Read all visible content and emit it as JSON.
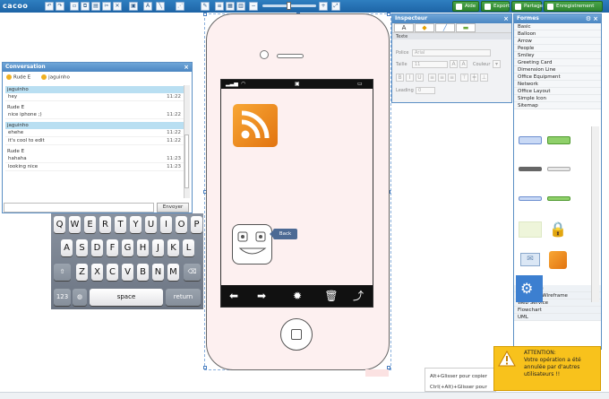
{
  "toolbar": {
    "logo": "cacoo",
    "help_label": "Aide",
    "export_label": "Export",
    "share_label": "Partage",
    "save_label": "Enregistrement"
  },
  "conversation": {
    "title": "Conversation",
    "users": [
      "Rude E",
      "jaguinho"
    ],
    "messages": [
      {
        "author": "jaguinho",
        "highlight": true,
        "lines": [
          {
            "text": "hey",
            "time": "11:22"
          }
        ]
      },
      {
        "author": "Rude E",
        "highlight": false,
        "lines": [
          {
            "text": "nice iphone ;)",
            "time": "11:22"
          }
        ]
      },
      {
        "author": "jaguinho",
        "highlight": true,
        "lines": [
          {
            "text": "ehehe",
            "time": "11:22"
          },
          {
            "text": "it's cool to edit",
            "time": "11:22"
          }
        ]
      },
      {
        "author": "Rude E",
        "highlight": false,
        "lines": [
          {
            "text": "hahaha",
            "time": "11:23"
          },
          {
            "text": "looking nice",
            "time": "11:23"
          }
        ]
      }
    ],
    "send_label": "Envoyer"
  },
  "keyboard": {
    "row1": [
      "Q",
      "W",
      "E",
      "R",
      "T",
      "Y",
      "U",
      "I",
      "O",
      "P"
    ],
    "row2": [
      "A",
      "S",
      "D",
      "F",
      "G",
      "H",
      "J",
      "K",
      "L"
    ],
    "row3": [
      "Z",
      "X",
      "C",
      "V",
      "B",
      "N",
      "M"
    ],
    "numbers_label": "123",
    "space_label": "space",
    "return_label": "return"
  },
  "phone": {
    "back_label": "Back"
  },
  "inspector": {
    "title": "Inspecteur",
    "section": "Texte",
    "police_label": "Police",
    "police_value": "Arial",
    "taille_label": "Taille",
    "taille_value": "11",
    "couleur_label": "Couleur",
    "leading_label": "Leading",
    "leading_value": "0"
  },
  "shapes": {
    "title": "Formes",
    "categories_top": [
      "Basic",
      "Balloon",
      "Arrow",
      "People",
      "Smiley",
      "Greeting Card",
      "Dimension Line",
      "Office Equipment",
      "Network",
      "Office Layout",
      "Simple Icon",
      "Sitemap"
    ],
    "categories_bottom": [
      "Wireframe",
      "Freehand Wireframe",
      "Web Service",
      "Flowchart",
      "UML"
    ]
  },
  "tooltip": {
    "line1": "Alt+Glisser pour copier",
    "line2": "Ctrl(+Alt)+Glisser pour"
  },
  "warning": {
    "heading": "ATTENTION:",
    "body": "Votre opération a été annulée par d'autres utilisateurs !!"
  }
}
